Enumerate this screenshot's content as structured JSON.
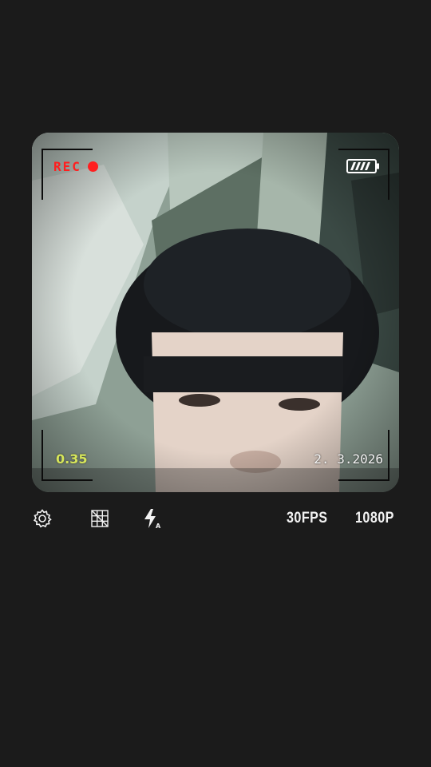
{
  "viewfinder": {
    "rec_label": "REC",
    "zoom_value": "0.35",
    "date_text": "2. 3.2026"
  },
  "toolbar": {
    "fps_label": "30FPS",
    "resolution_label": "1080P"
  },
  "colors": {
    "rec_red": "#ff1f1f",
    "zoom_yellow": "#d6e55a",
    "background": "#1b1b1b",
    "text": "#f2f2f2"
  },
  "icons": [
    "settings-gear-icon",
    "grid-icon",
    "flash-auto-icon",
    "battery-icon",
    "record-dot-icon"
  ]
}
